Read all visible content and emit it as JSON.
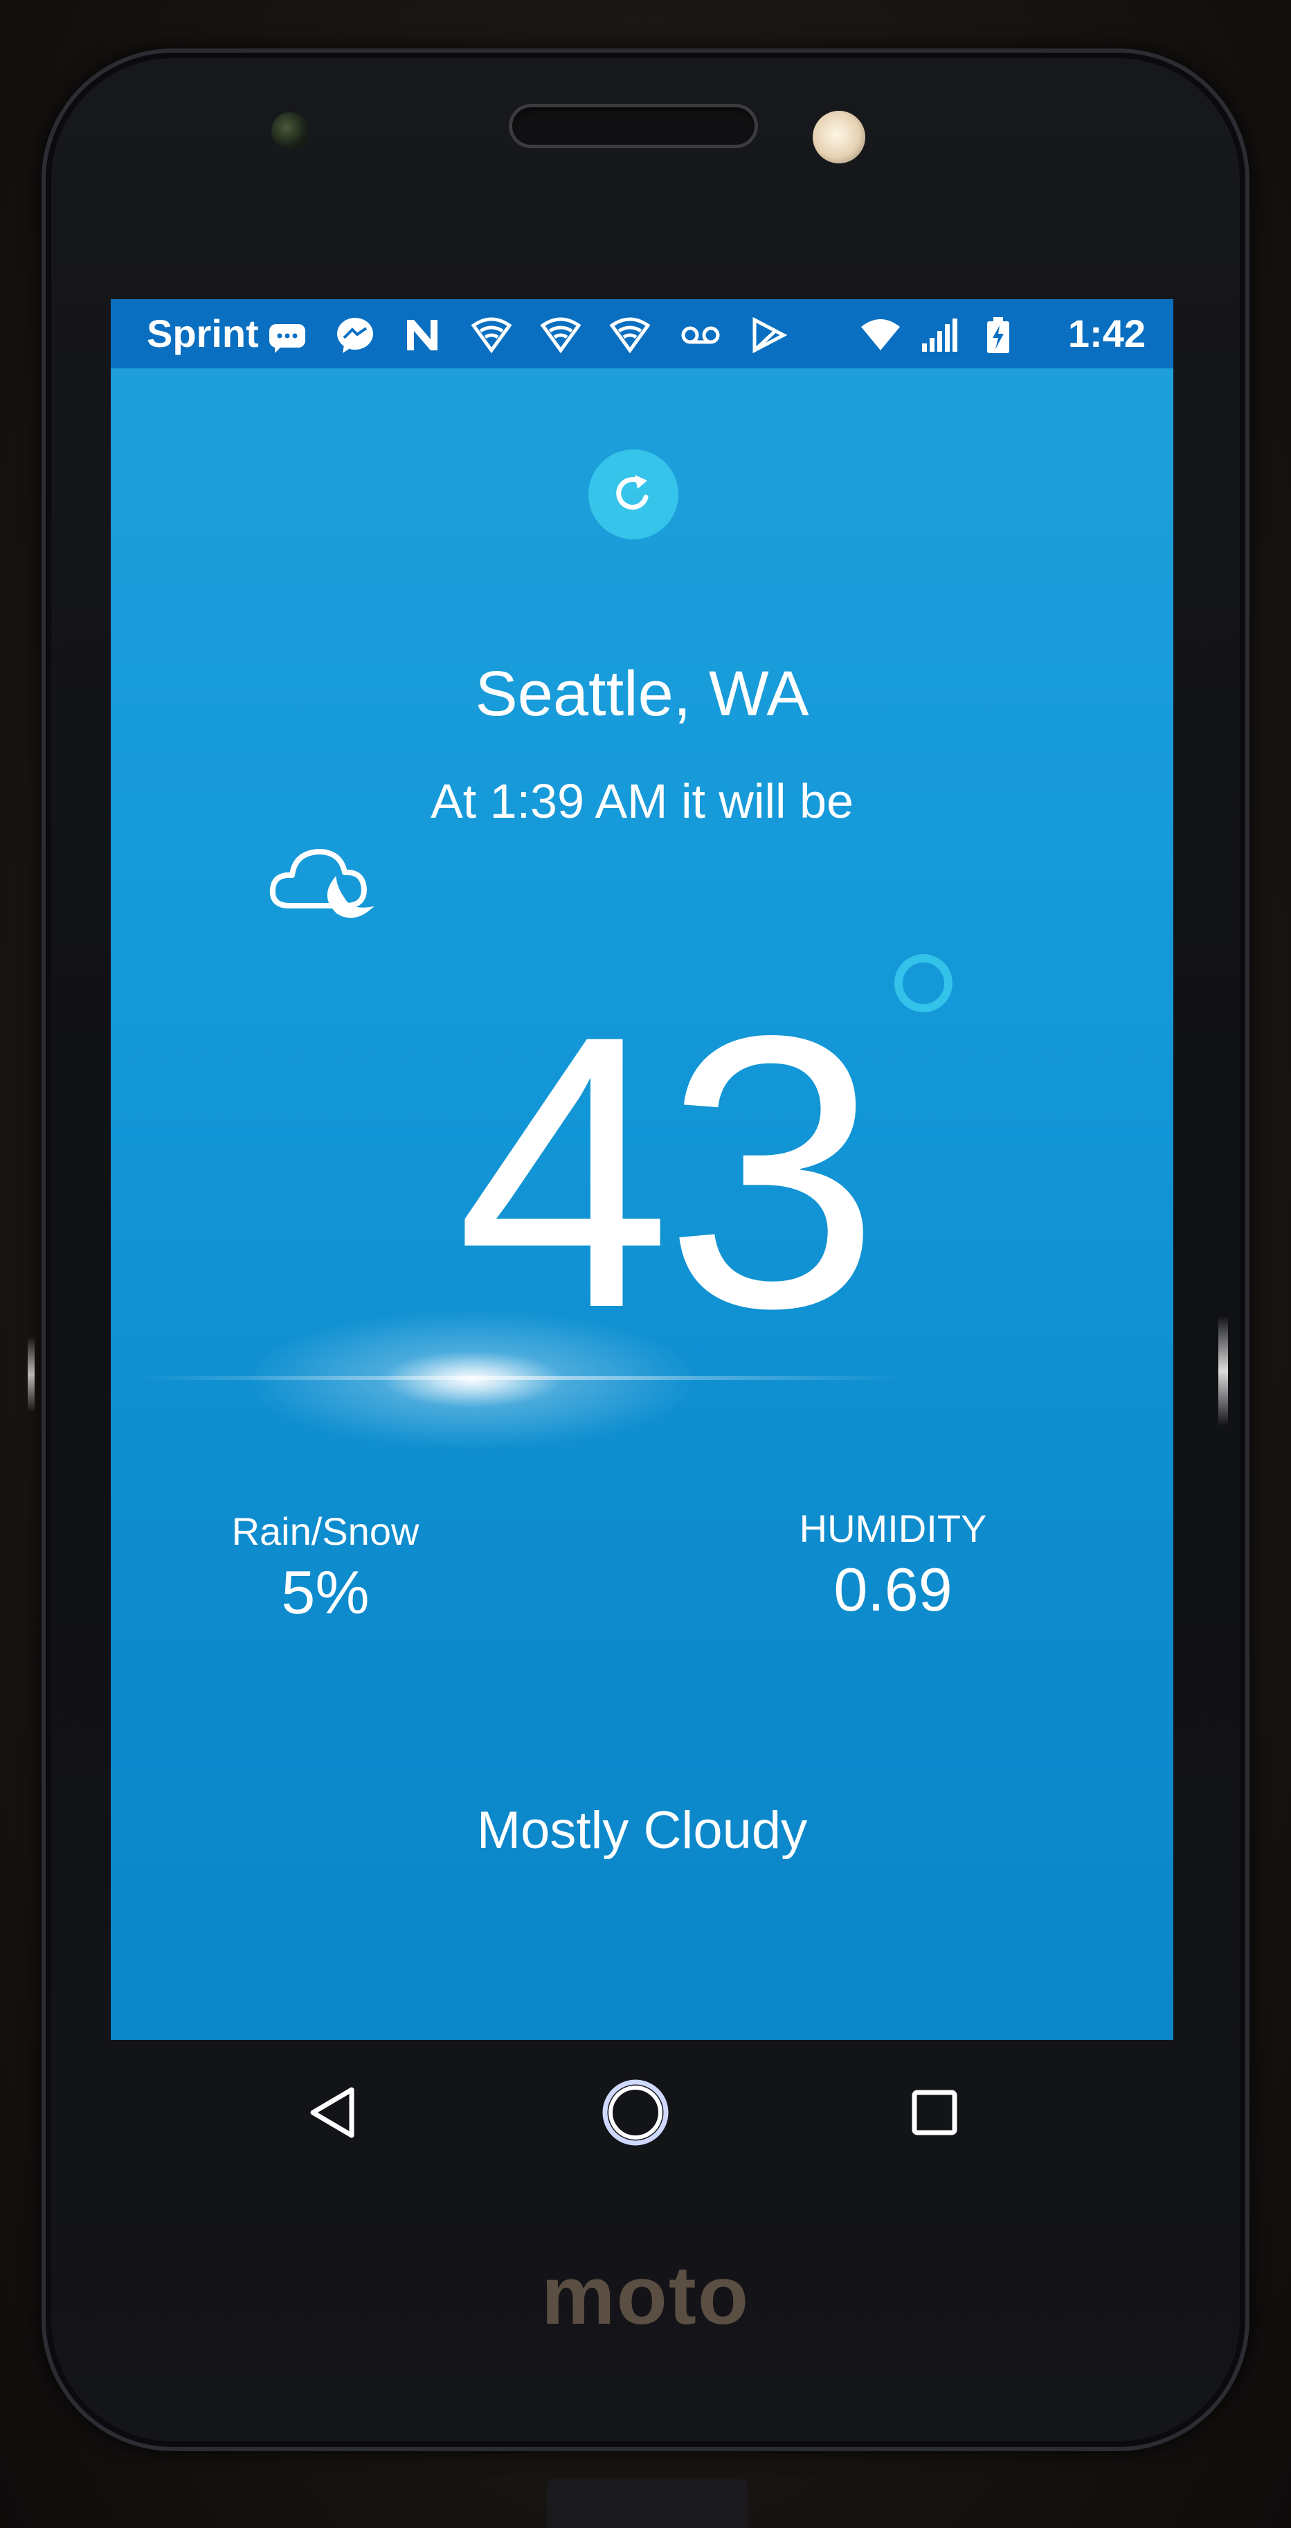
{
  "statusbar": {
    "carrier": "Sprint",
    "time": "1:42",
    "icons": [
      "sms-icon",
      "messenger-icon",
      "n-icon",
      "wifi-hotspot-icon",
      "wifi-hotspot-icon",
      "wifi-hotspot-icon",
      "voicemail-icon",
      "play-store-icon",
      "wifi-icon",
      "signal-icon",
      "battery-icon"
    ]
  },
  "weather": {
    "location": "Seattle, WA",
    "forecast_time_text": "At 1:39 AM it will be",
    "icon": "cloud-moon-icon",
    "temperature": "43",
    "rain_snow_label": "Rain/Snow",
    "rain_snow_value": "5%",
    "humidity_label": "HUMIDITY",
    "humidity_value": "0.69",
    "condition": "Mostly Cloudy"
  },
  "navbar": {
    "back": "back-icon",
    "home": "home-icon",
    "recents": "recents-icon"
  },
  "device": {
    "brand": "moto"
  },
  "colors": {
    "screen_background": "#1498d8",
    "statusbar_background": "#0a6fc0",
    "accent": "#36c4ea",
    "text": "#ffffff"
  }
}
